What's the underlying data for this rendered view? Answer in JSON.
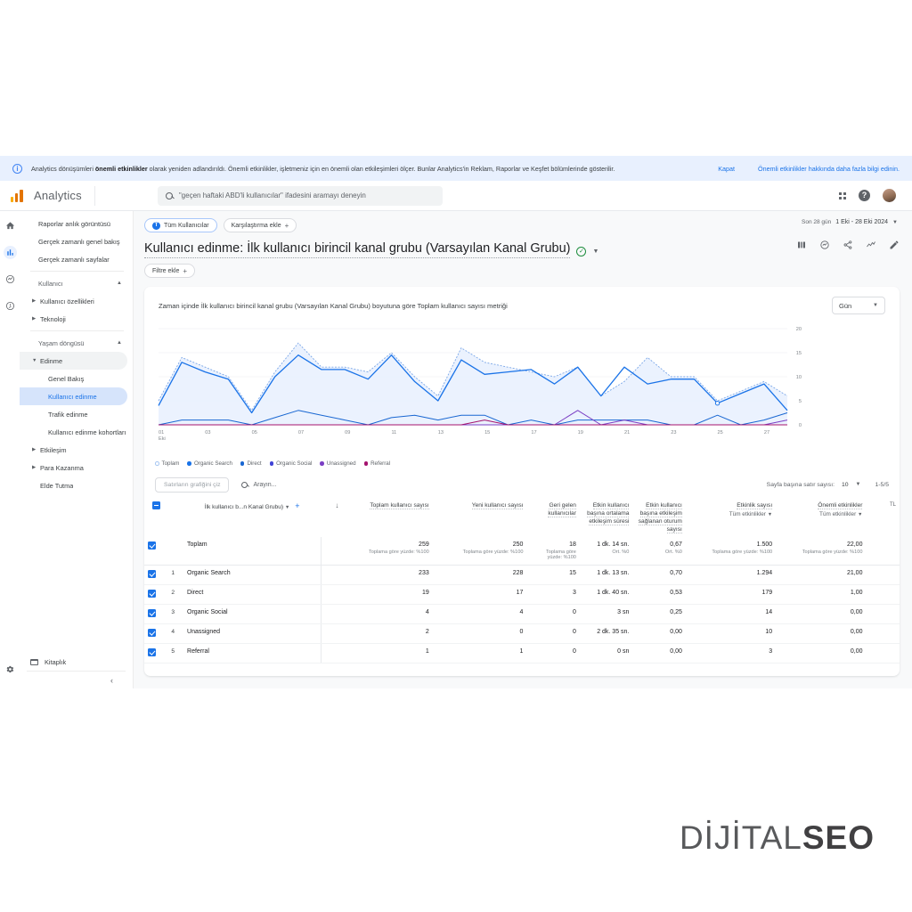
{
  "banner": {
    "text_pre": "Analytics dönüşümleri ",
    "text_bold": "önemli etkinlikler",
    "text_post": " olarak yeniden adlandırıldı. Önemli etkinlikler, işletmeniz için en önemli olan etkileşimleri ölçer. Bunlar Analytics'in Reklam, Raporlar ve Keşfet bölümlerinde gösterilir.",
    "close_label": "Kapat",
    "learn_more_label": "Önemli etkinlikler hakkında daha fazla bilgi edinin."
  },
  "topbar": {
    "brand": "Analytics",
    "search_placeholder": "\"geçen haftaki ABD'li kullanıcılar\" ifadesini aramayı deneyin"
  },
  "rail": {
    "items": [
      {
        "name": "home-icon"
      },
      {
        "name": "reports-icon"
      },
      {
        "name": "explore-icon"
      },
      {
        "name": "advertising-icon"
      }
    ],
    "settings": "gear-icon"
  },
  "sidebar": {
    "items": [
      {
        "label": "Raporlar anlık görüntüsü",
        "type": "link"
      },
      {
        "label": "Gerçek zamanlı genel bakış",
        "type": "link"
      },
      {
        "label": "Gerçek zamanlı sayfalar",
        "type": "link"
      },
      {
        "label": "Kullanıcı",
        "type": "section"
      },
      {
        "label": "Kullanıcı özellikleri",
        "type": "expandable"
      },
      {
        "label": "Teknoloji",
        "type": "expandable"
      },
      {
        "label": "Yaşam döngüsü",
        "type": "section"
      },
      {
        "label": "Edinme",
        "type": "group-open"
      },
      {
        "label": "Genel Bakış",
        "type": "child"
      },
      {
        "label": "Kullanıcı edinme",
        "type": "child-selected"
      },
      {
        "label": "Trafik edinme",
        "type": "child"
      },
      {
        "label": "Kullanıcı edinme kohortları",
        "type": "child"
      },
      {
        "label": "Etkileşim",
        "type": "expandable"
      },
      {
        "label": "Para Kazanma",
        "type": "expandable"
      },
      {
        "label": "Elde Tutma",
        "type": "link"
      }
    ],
    "library_label": "Kitaplık"
  },
  "chips": {
    "audience": "Tüm Kullanıcılar",
    "audience_badge": "T",
    "add_comparison": "Karşılaştırma ekle",
    "add_filter": "Filtre ekle"
  },
  "daterange": {
    "preset": "Son 28 gün",
    "range": "1 Eki - 28 Eki 2024"
  },
  "page": {
    "title": "Kullanıcı edinme: İlk kullanıcı birincil kanal grubu (Varsayılan Kanal Grubu)"
  },
  "toolbar": {
    "icons": [
      "compare-icon",
      "insights-icon",
      "share-icon",
      "trend-icon",
      "edit-icon"
    ]
  },
  "chart_header": {
    "title": "Zaman içinde İlk kullanıcı birincil kanal grubu (Varsayılan Kanal Grubu) boyutuna göre Toplam kullanıcı sayısı metriği",
    "granularity": "Gün"
  },
  "chart_data": {
    "type": "line",
    "title": "Zaman içinde İlk kullanıcı birincil kanal grubu (Varsayılan Kanal Grubu) boyutuna göre Toplam kullanıcı sayısı metriği",
    "xlabel": "Eki",
    "ylabel": "",
    "ylim": [
      0,
      20
    ],
    "yticks": [
      0,
      5,
      10,
      15,
      20
    ],
    "x": [
      "01",
      "02",
      "03",
      "04",
      "05",
      "06",
      "07",
      "08",
      "09",
      "10",
      "11",
      "12",
      "13",
      "14",
      "15",
      "16",
      "17",
      "18",
      "19",
      "20",
      "21",
      "22",
      "23",
      "24",
      "25",
      "26",
      "27",
      "28"
    ],
    "xticks": [
      "01",
      "03",
      "05",
      "07",
      "09",
      "11",
      "13",
      "15",
      "17",
      "19",
      "21",
      "23",
      "25",
      "27"
    ],
    "x_axis_note": "Eki",
    "grid": true,
    "legend_position": "bottom",
    "series": [
      {
        "name": "Toplam",
        "color": "#aecbfa",
        "style": "dotted-area",
        "values": [
          5,
          14,
          12,
          10,
          3,
          11,
          17,
          12,
          12,
          11,
          15,
          10,
          6,
          16,
          13,
          12,
          11,
          10,
          12,
          6,
          9,
          14,
          10,
          10,
          5,
          7,
          9,
          6
        ]
      },
      {
        "name": "Organic Search",
        "color": "#1a73e8",
        "style": "solid",
        "values": [
          4,
          13,
          11,
          9.5,
          2.5,
          10,
          14.5,
          11.5,
          11.5,
          9.5,
          14.5,
          9,
          5,
          13.5,
          10.5,
          11,
          11.5,
          8.5,
          12,
          6,
          12,
          8.5,
          9.5,
          9.5,
          4.5,
          6.5,
          8.5,
          3
        ]
      },
      {
        "name": "Direct",
        "color": "#1967d2",
        "style": "solid",
        "values": [
          0,
          1,
          1,
          1,
          0,
          1.5,
          3,
          2,
          1,
          0,
          1.5,
          2,
          1,
          2,
          2,
          0,
          1,
          0,
          1,
          1,
          1,
          1,
          0,
          0,
          2,
          0,
          1,
          2.5
        ]
      },
      {
        "name": "Organic Social",
        "color": "#4043d6",
        "style": "solid",
        "values": [
          0,
          0,
          0,
          0,
          0,
          0,
          0,
          0,
          0,
          0,
          0,
          0,
          0,
          0,
          0,
          0,
          0,
          0,
          0,
          0,
          0,
          0,
          0,
          0,
          0,
          0,
          0,
          0
        ]
      },
      {
        "name": "Unassigned",
        "color": "#7b3fc4",
        "style": "solid",
        "values": [
          0,
          0,
          0,
          0,
          0,
          0,
          0,
          0,
          0,
          0,
          0,
          0,
          0,
          0,
          0,
          0,
          0,
          0,
          3,
          0,
          1,
          0,
          0,
          0,
          0,
          0,
          0,
          1
        ]
      },
      {
        "name": "Referral",
        "color": "#a4136e",
        "style": "solid",
        "values": [
          0,
          0,
          0,
          0,
          0,
          0,
          0,
          0,
          0,
          0,
          0,
          0,
          0,
          0,
          1,
          0,
          0,
          0,
          0,
          0,
          0,
          0,
          0,
          0,
          0,
          0,
          0,
          0
        ]
      }
    ]
  },
  "legend": [
    {
      "label": "Toplam",
      "color": "#aecbfa",
      "hollow": true
    },
    {
      "label": "Organic Search",
      "color": "#1a73e8",
      "hollow": false
    },
    {
      "label": "Direct",
      "color": "#1967d2",
      "hollow": false
    },
    {
      "label": "Organic Social",
      "color": "#4043d6",
      "hollow": false
    },
    {
      "label": "Unassigned",
      "color": "#7b3fc4",
      "hollow": false
    },
    {
      "label": "Referral",
      "color": "#a4136e",
      "hollow": false
    }
  ],
  "table_controls": {
    "plot_rows_label": "Satırların grafiğini çiz",
    "search_placeholder": "Arayın...",
    "rows_per_page_label": "Sayfa başına satır sayısı:",
    "rows_per_page_value": "10",
    "range_label": "1-5/5"
  },
  "table": {
    "dimension_header": "İlk kullanıcı b...n Kanal Grubu)",
    "headers": [
      {
        "title": "Toplam kullanıcı sayısı",
        "sub": null
      },
      {
        "title": "Yeni kullanıcı sayısı",
        "sub": null
      },
      {
        "title": "Geri gelen kullanıcılar",
        "sub": null
      },
      {
        "title": "Etkin kullanıcı başına ortalama etkileşim süresi",
        "sub": null
      },
      {
        "title": "Etkin kullanıcı başına etkileşim sağlanan oturum sayısı",
        "sub": null
      },
      {
        "title": "Etkinlik sayısı",
        "sub": "Tüm etkinlikler"
      },
      {
        "title": "Önemli etkinlikler",
        "sub": "Tüm etkinlikler"
      },
      {
        "title": "TL",
        "sub": null
      }
    ],
    "total_row": {
      "label": "Toplam",
      "values": [
        "259",
        "250",
        "18",
        "1 dk. 14 sn.",
        "0,67",
        "1.500",
        "22,00"
      ],
      "subs": [
        "Toplama göre yüzde: %100",
        "Toplama göre yüzde: %100",
        "Toplama göre yüzde: %100",
        "Ort. %0",
        "Ort. %0",
        "Toplama göre yüzde: %100",
        "Toplama göre yüzde: %100"
      ]
    },
    "rows": [
      {
        "idx": "1",
        "label": "Organic Search",
        "values": [
          "233",
          "228",
          "15",
          "1 dk. 13 sn.",
          "0,70",
          "1.294",
          "21,00"
        ]
      },
      {
        "idx": "2",
        "label": "Direct",
        "values": [
          "19",
          "17",
          "3",
          "1 dk. 40 sn.",
          "0,53",
          "179",
          "1,00"
        ]
      },
      {
        "idx": "3",
        "label": "Organic Social",
        "values": [
          "4",
          "4",
          "0",
          "3 sn",
          "0,25",
          "14",
          "0,00"
        ]
      },
      {
        "idx": "4",
        "label": "Unassigned",
        "values": [
          "2",
          "0",
          "0",
          "2 dk. 35 sn.",
          "0,00",
          "10",
          "0,00"
        ]
      },
      {
        "idx": "5",
        "label": "Referral",
        "values": [
          "1",
          "1",
          "0",
          "0 sn",
          "0,00",
          "3",
          "0,00"
        ]
      }
    ]
  },
  "watermark": {
    "light": "DİJİTAL",
    "bold": "SEO"
  }
}
